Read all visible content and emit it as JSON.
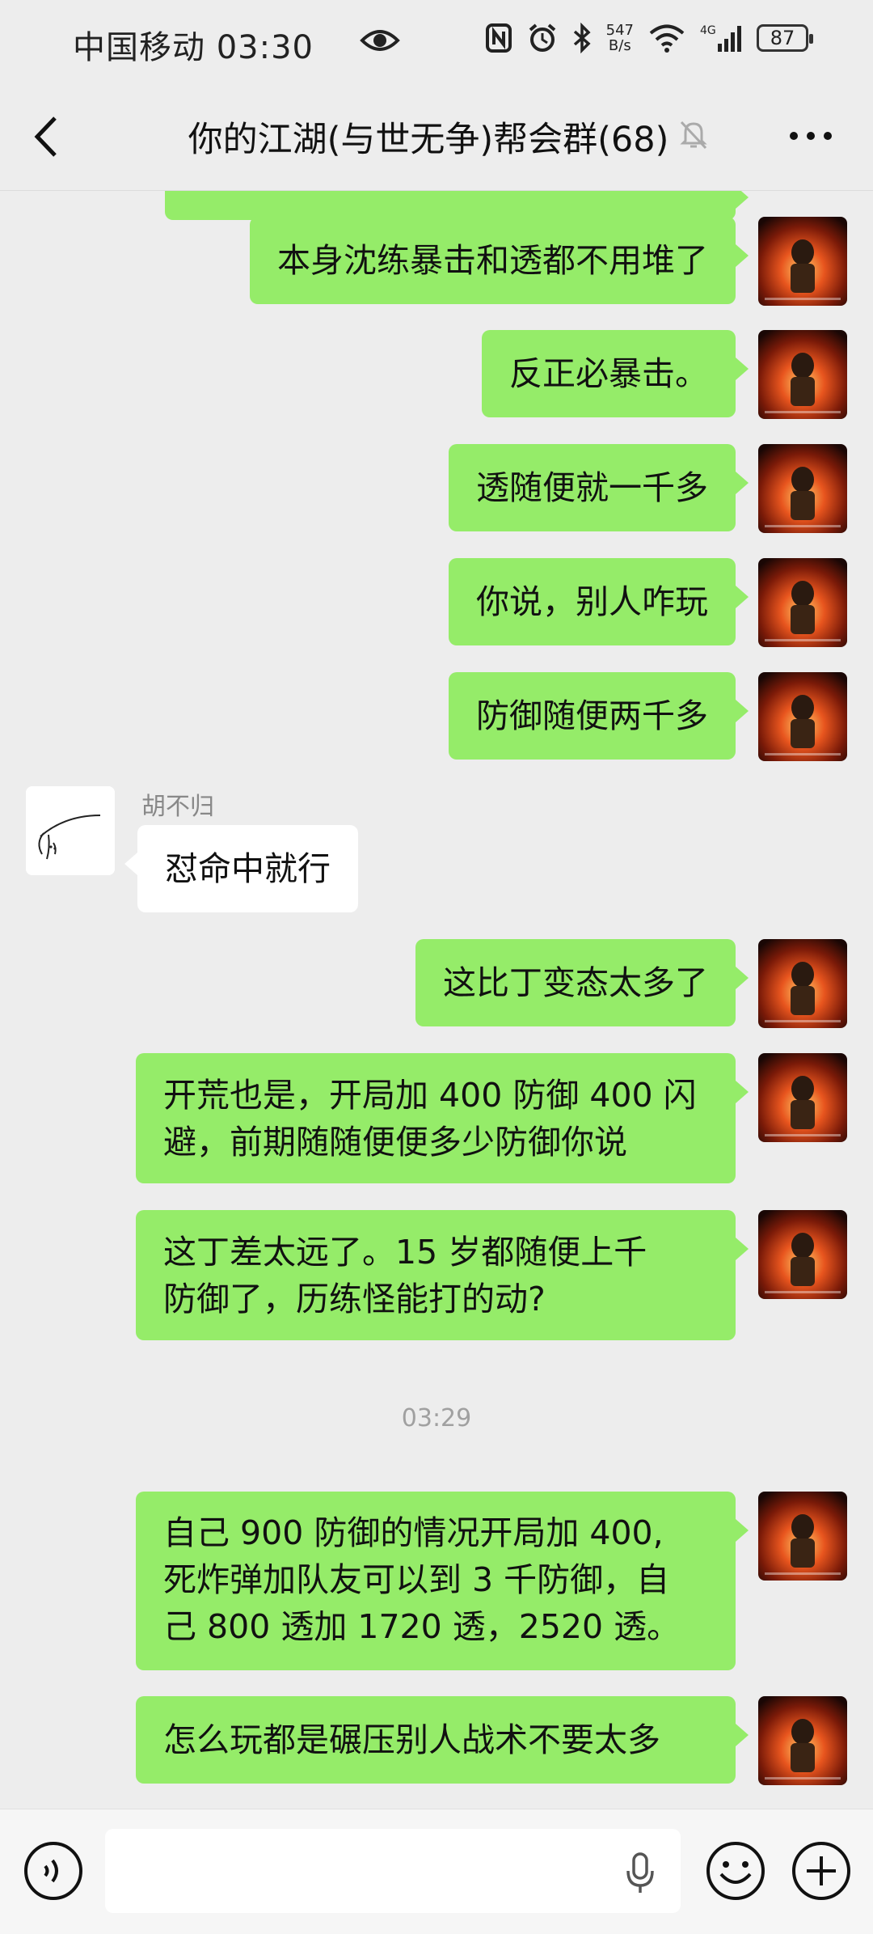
{
  "status_bar": {
    "carrier_time": "中国移动 03:30",
    "net_speed_top": "547",
    "net_speed_bottom": "B/s",
    "battery": "87"
  },
  "nav": {
    "title": "你的江湖(与世无争)帮会群(68)"
  },
  "messages": [
    {
      "side": "me",
      "text": "本身沈练暴击和透都不用堆了"
    },
    {
      "side": "me",
      "text": "反正必暴击。"
    },
    {
      "side": "me",
      "text": "透随便就一千多"
    },
    {
      "side": "me",
      "text": "你说，别人咋玩"
    },
    {
      "side": "me",
      "text": "防御随便两千多"
    },
    {
      "side": "other",
      "sender": "胡不归",
      "text": "怼命中就行"
    },
    {
      "side": "me",
      "text": "这比丁变态太多了"
    },
    {
      "side": "me",
      "lines": [
        "开荒也是，开局加 400 防御 400 闪",
        "避，前期随随便便多少防御你说"
      ]
    },
    {
      "side": "me",
      "lines": [
        "这丁差太远了。15 岁都随便上千",
        "防御了，历练怪能打的动?"
      ]
    },
    {
      "side": "time",
      "text": "03:29"
    },
    {
      "side": "me",
      "lines": [
        "自己 900 防御的情况开局加 400,",
        "死炸弹加队友可以到 3 千防御，自",
        "己 800 透加 1720 透，2520 透。"
      ]
    },
    {
      "side": "me",
      "text": "怎么玩都是碾压别人战术不要太多"
    }
  ],
  "input": {
    "value": "",
    "placeholder": ""
  },
  "colors": {
    "background": "#ededed",
    "my_bubble": "#95ec69",
    "other_bubble": "#ffffff"
  },
  "icons": [
    "eye-icon",
    "nfc-icon",
    "alarm-icon",
    "bluetooth-icon",
    "wifi-icon",
    "signal-icon",
    "back-icon",
    "mute-bell-icon",
    "more-icon",
    "voice-icon",
    "mic-icon",
    "emoji-icon",
    "plus-icon"
  ]
}
